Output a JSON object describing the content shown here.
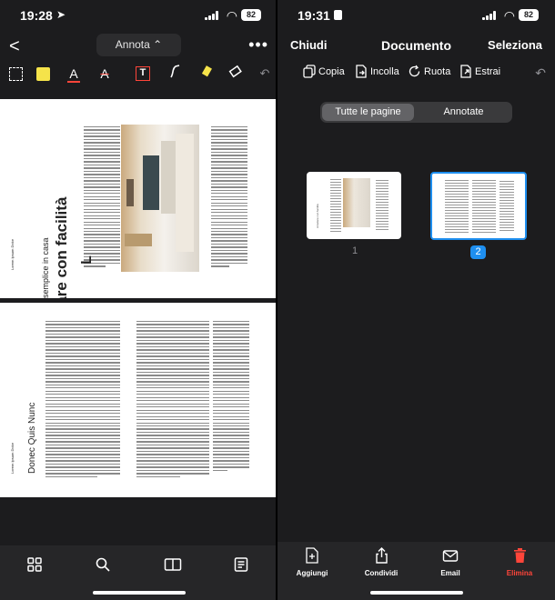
{
  "left": {
    "status": {
      "time": "19:28",
      "battery": "82"
    },
    "topbar": {
      "mode_label": "Annota ⌃"
    },
    "tools": [
      "selection-tool",
      "highlighter-yellow",
      "text-color-tool",
      "strikethrough-tool",
      "text-box-tool",
      "pen-tool",
      "marker-tool",
      "eraser-tool",
      "undo"
    ],
    "page1": {
      "subtitle": "Lo stile semplice in casa",
      "title": "Arredare con facilità",
      "side_text": "Lorem Ipsum Dolor",
      "drop_cap": "L"
    },
    "page2": {
      "title": "Donec Quis Nunc",
      "side_text": "Lorem Ipsum Dolor"
    },
    "bottom_icons": [
      "grid-icon",
      "search-icon",
      "book-icon",
      "document-list-icon"
    ]
  },
  "right": {
    "status": {
      "time": "19:31",
      "battery": "82"
    },
    "nav": {
      "left": "Chiudi",
      "title": "Documento",
      "right": "Seleziona"
    },
    "actions": [
      {
        "label": "Copia",
        "icon": "copy-icon"
      },
      {
        "label": "Incolla",
        "icon": "paste-icon"
      },
      {
        "label": "Ruota",
        "icon": "rotate-icon"
      },
      {
        "label": "Estrai",
        "icon": "extract-icon"
      }
    ],
    "segments": {
      "all": "Tutte le pagine",
      "annotated": "Annotate"
    },
    "thumbs": [
      {
        "page": "1",
        "title": "Arredare con facilità",
        "selected": false
      },
      {
        "page": "2",
        "selected": true
      }
    ],
    "bottom": [
      {
        "label": "Aggiungi",
        "icon": "add-page-icon"
      },
      {
        "label": "Condividi",
        "icon": "share-icon"
      },
      {
        "label": "Email",
        "icon": "email-icon"
      },
      {
        "label": "Elimina",
        "icon": "trash-icon"
      }
    ],
    "colors": {
      "accent": "#1e8ff0",
      "danger": "#ff453a",
      "highlight": "#f5e34a"
    }
  }
}
